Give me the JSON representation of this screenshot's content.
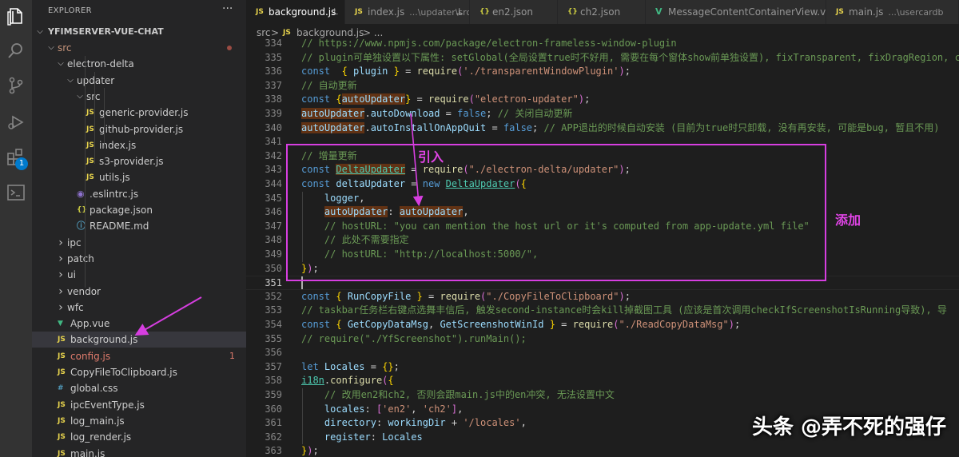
{
  "activity_bar": {
    "icons": [
      "files-icon",
      "search-icon",
      "source-control-icon",
      "run-debug-icon",
      "extensions-icon",
      "remote-explorer-icon"
    ],
    "extensions_badge": "1"
  },
  "sidebar": {
    "title": "EXPLORER",
    "more_actions": "···",
    "root": "YFIMSERVER-VUE-CHAT",
    "items": [
      {
        "label": "src",
        "type": "folder",
        "depth": 1,
        "open": true,
        "modified": true
      },
      {
        "label": "electron-delta",
        "type": "folder",
        "depth": 2,
        "open": true
      },
      {
        "label": "updater",
        "type": "folder",
        "depth": 3,
        "open": true
      },
      {
        "label": "src",
        "type": "folder",
        "depth": 4,
        "open": true
      },
      {
        "label": "generic-provider.js",
        "type": "js",
        "depth": 5
      },
      {
        "label": "github-provider.js",
        "type": "js",
        "depth": 5
      },
      {
        "label": "index.js",
        "type": "js",
        "depth": 5
      },
      {
        "label": "s3-provider.js",
        "type": "js",
        "depth": 5
      },
      {
        "label": "utils.js",
        "type": "js",
        "depth": 5
      },
      {
        "label": ".eslintrc.js",
        "type": "eslint",
        "depth": 4
      },
      {
        "label": "package.json",
        "type": "json",
        "depth": 4
      },
      {
        "label": "README.md",
        "type": "md",
        "depth": 4
      },
      {
        "label": "ipc",
        "type": "folder",
        "depth": 2,
        "open": false
      },
      {
        "label": "patch",
        "type": "folder",
        "depth": 2,
        "open": false
      },
      {
        "label": "ui",
        "type": "folder",
        "depth": 2,
        "open": false
      },
      {
        "label": "vendor",
        "type": "folder",
        "depth": 2,
        "open": false
      },
      {
        "label": "wfc",
        "type": "folder",
        "depth": 2,
        "open": false
      },
      {
        "label": "App.vue",
        "type": "vue",
        "depth": 2
      },
      {
        "label": "background.js",
        "type": "js",
        "depth": 2,
        "selected": true
      },
      {
        "label": "config.js",
        "type": "js",
        "depth": 2,
        "error": true,
        "problems": "1"
      },
      {
        "label": "CopyFileToClipboard.js",
        "type": "js",
        "depth": 2
      },
      {
        "label": "global.css",
        "type": "css",
        "depth": 2
      },
      {
        "label": "ipcEventType.js",
        "type": "js",
        "depth": 2
      },
      {
        "label": "log_main.js",
        "type": "js",
        "depth": 2
      },
      {
        "label": "log_render.js",
        "type": "js",
        "depth": 2
      },
      {
        "label": "main.js",
        "type": "js",
        "depth": 2
      }
    ]
  },
  "tabs": [
    {
      "icon": "JS",
      "label": "background.js",
      "desc": "",
      "active": true,
      "pinned": true
    },
    {
      "icon": "JS",
      "label": "index.js",
      "desc": "...\\updater\\src",
      "active": false,
      "pinned": true
    },
    {
      "icon": "{}",
      "label": "en2.json",
      "desc": "",
      "active": false
    },
    {
      "icon": "{}",
      "label": "ch2.json",
      "desc": "",
      "active": false
    },
    {
      "icon": "V",
      "label": "MessageContentContainerView.vue",
      "desc": "",
      "active": false
    },
    {
      "icon": "JS",
      "label": "main.js",
      "desc": "...\\usercardb",
      "active": false
    }
  ],
  "breadcrumb": {
    "folder": "src",
    "sep": ">",
    "file_icon": "JS",
    "file": "background.js",
    "more": "> ..."
  },
  "editor": {
    "current_line": 351,
    "lines": [
      {
        "n": 334,
        "t": [
          [
            "c",
            "// https://www.npmjs.com/package/electron-frameless-window-plugin"
          ]
        ]
      },
      {
        "n": 335,
        "t": [
          [
            "c",
            "// plugin可单独设置以下属性: setGlobal(全局设置true时不好用, 需要在每个窗体show前单独设置), fixTransparent, fixDragRegion, c"
          ]
        ]
      },
      {
        "n": 336,
        "t": [
          [
            "k",
            "const"
          ],
          [
            "",
            "  "
          ],
          [
            "y",
            "{"
          ],
          [
            "",
            " "
          ],
          [
            "v",
            "plugin"
          ],
          [
            "",
            " "
          ],
          [
            "y",
            "}"
          ],
          [
            "",
            " = "
          ],
          [
            "f",
            "require"
          ],
          [
            "p",
            "("
          ],
          [
            "s",
            "'./transparentWindowPlugin'"
          ],
          [
            "p",
            ")"
          ],
          [
            "",
            ";"
          ]
        ]
      },
      {
        "n": 337,
        "t": [
          [
            "c",
            "// 自动更新"
          ]
        ]
      },
      {
        "n": 338,
        "t": [
          [
            "k",
            "const"
          ],
          [
            "",
            " "
          ],
          [
            "y",
            "{"
          ],
          [
            "vh",
            "autoUpdater"
          ],
          [
            "y",
            "}"
          ],
          [
            "",
            " = "
          ],
          [
            "f",
            "require"
          ],
          [
            "p",
            "("
          ],
          [
            "s",
            "\"electron-updater\""
          ],
          [
            "p",
            ")"
          ],
          [
            "",
            ";"
          ]
        ]
      },
      {
        "n": 339,
        "t": [
          [
            "vh",
            "autoUpdater"
          ],
          [
            "",
            "."
          ],
          [
            "v",
            "autoDownload"
          ],
          [
            "",
            " = "
          ],
          [
            "k",
            "false"
          ],
          [
            "",
            ";"
          ],
          [
            "",
            " "
          ],
          [
            "c",
            "// 关闭自动更新"
          ]
        ]
      },
      {
        "n": 340,
        "t": [
          [
            "vh",
            "autoUpdater"
          ],
          [
            "",
            "."
          ],
          [
            "v",
            "autoInstallOnAppQuit"
          ],
          [
            "",
            " = "
          ],
          [
            "k",
            "false"
          ],
          [
            "",
            ";"
          ],
          [
            "",
            " "
          ],
          [
            "c",
            "// APP退出的时候自动安装 (目前为true时只卸载, 没有再安装, 可能是bug, 暂且不用)"
          ]
        ]
      },
      {
        "n": 341,
        "t": []
      },
      {
        "n": 342,
        "t": [
          [
            "c",
            "// 增量更新"
          ]
        ]
      },
      {
        "n": 343,
        "t": [
          [
            "k",
            "const"
          ],
          [
            "",
            " "
          ],
          [
            "vhu",
            "DeltaUpdater"
          ],
          [
            "",
            " = "
          ],
          [
            "f",
            "require"
          ],
          [
            "p",
            "("
          ],
          [
            "s",
            "\"./electron-delta/updater\""
          ],
          [
            "p",
            ")"
          ],
          [
            "",
            ";"
          ]
        ]
      },
      {
        "n": 344,
        "t": [
          [
            "k",
            "const"
          ],
          [
            "",
            " "
          ],
          [
            "v",
            "deltaUpdater"
          ],
          [
            "",
            " = "
          ],
          [
            "k",
            "new"
          ],
          [
            "",
            " "
          ],
          [
            "tu",
            "DeltaUpdater"
          ],
          [
            "p",
            "("
          ],
          [
            "y",
            "{"
          ]
        ]
      },
      {
        "n": 345,
        "t": [
          [
            "",
            "    "
          ],
          [
            "v",
            "logger"
          ],
          [
            "",
            ","
          ]
        ]
      },
      {
        "n": 346,
        "t": [
          [
            "",
            "    "
          ],
          [
            "vh",
            "autoUpdater"
          ],
          [
            "",
            ": "
          ],
          [
            "vh",
            "autoUpdater"
          ],
          [
            "",
            ","
          ]
        ]
      },
      {
        "n": 347,
        "t": [
          [
            "",
            "    "
          ],
          [
            "c",
            "// hostURL: \"you can mention the host url or it's computed from app-update.yml file\""
          ]
        ]
      },
      {
        "n": 348,
        "t": [
          [
            "",
            "    "
          ],
          [
            "c",
            "// 此处不需要指定"
          ]
        ]
      },
      {
        "n": 349,
        "t": [
          [
            "",
            "    "
          ],
          [
            "c",
            "// hostURL: \"http://localhost:5000/\","
          ]
        ]
      },
      {
        "n": 350,
        "t": [
          [
            "y",
            "}"
          ],
          [
            "p",
            ")"
          ],
          [
            "",
            ";"
          ]
        ]
      },
      {
        "n": 351,
        "t": []
      },
      {
        "n": 352,
        "t": [
          [
            "k",
            "const"
          ],
          [
            "",
            " "
          ],
          [
            "y",
            "{"
          ],
          [
            "",
            " "
          ],
          [
            "v",
            "RunCopyFile"
          ],
          [
            "",
            " "
          ],
          [
            "y",
            "}"
          ],
          [
            "",
            " = "
          ],
          [
            "f",
            "require"
          ],
          [
            "p",
            "("
          ],
          [
            "s",
            "\"./CopyFileToClipboard\""
          ],
          [
            "p",
            ")"
          ],
          [
            "",
            ";"
          ]
        ]
      },
      {
        "n": 353,
        "t": [
          [
            "c",
            "// taskbar任务栏右键点选舞丰信后, 触发second-instance时会kill掉截图工具 (应该是首次调用checkIfScreenshotIsRunning导致), 导"
          ]
        ]
      },
      {
        "n": 354,
        "t": [
          [
            "k",
            "const"
          ],
          [
            "",
            " "
          ],
          [
            "y",
            "{"
          ],
          [
            "",
            " "
          ],
          [
            "v",
            "GetCopyDataMsg"
          ],
          [
            "",
            ", "
          ],
          [
            "v",
            "GetScreenshotWinId"
          ],
          [
            "",
            " "
          ],
          [
            "y",
            "}"
          ],
          [
            "",
            " = "
          ],
          [
            "f",
            "require"
          ],
          [
            "p",
            "("
          ],
          [
            "s",
            "\"./ReadCopyDataMsg\""
          ],
          [
            "p",
            ")"
          ],
          [
            "",
            ";"
          ]
        ]
      },
      {
        "n": 355,
        "t": [
          [
            "c",
            "// require(\"./YfScreenshot\").runMain();"
          ]
        ]
      },
      {
        "n": 356,
        "t": []
      },
      {
        "n": 357,
        "t": [
          [
            "k",
            "let"
          ],
          [
            "",
            " "
          ],
          [
            "v",
            "Locales"
          ],
          [
            "",
            " = "
          ],
          [
            "y",
            "{}"
          ],
          [
            "",
            ";"
          ]
        ]
      },
      {
        "n": 358,
        "t": [
          [
            "vu",
            "i18n"
          ],
          [
            "",
            "."
          ],
          [
            "f",
            "configure"
          ],
          [
            "p",
            "("
          ],
          [
            "y",
            "{"
          ]
        ]
      },
      {
        "n": 359,
        "t": [
          [
            "",
            "    "
          ],
          [
            "c",
            "// 改用en2和ch2, 否则会跟main.js中的en冲突, 无法设置中文"
          ]
        ]
      },
      {
        "n": 360,
        "t": [
          [
            "",
            "    "
          ],
          [
            "v",
            "locales"
          ],
          [
            "",
            ": "
          ],
          [
            "p",
            "["
          ],
          [
            "s",
            "'en2'"
          ],
          [
            "",
            ", "
          ],
          [
            "s",
            "'ch2'"
          ],
          [
            "p",
            "]"
          ],
          [
            "",
            ","
          ]
        ]
      },
      {
        "n": 361,
        "t": [
          [
            "",
            "    "
          ],
          [
            "v",
            "directory"
          ],
          [
            "",
            ": "
          ],
          [
            "v",
            "workingDir"
          ],
          [
            "",
            " + "
          ],
          [
            "s",
            "'/locales'"
          ],
          [
            "",
            ","
          ]
        ]
      },
      {
        "n": 362,
        "t": [
          [
            "",
            "    "
          ],
          [
            "v",
            "register"
          ],
          [
            "",
            ": "
          ],
          [
            "v",
            "Locales"
          ]
        ]
      },
      {
        "n": 363,
        "t": [
          [
            "y",
            "}"
          ],
          [
            "p",
            ")"
          ],
          [
            "",
            ";"
          ]
        ]
      }
    ]
  },
  "annotations": {
    "intro_label": "引入",
    "add_label": "添加",
    "accent_color": "#d63ee0"
  },
  "watermark": "头条 @弄不死的强仔",
  "colors": {
    "keyword": "#569cd6",
    "variable": "#9cdcfe",
    "function": "#dcdcaa",
    "string": "#ce9178",
    "comment": "#6a9955",
    "type": "#4ec9b0",
    "highlight": "#613214",
    "js_icon": "#e8d44d",
    "json_icon": "#cbcb41",
    "vue_icon": "#41b883",
    "css_icon": "#519aba",
    "md_icon": "#519aba",
    "error": "#e07b6c",
    "modified": "#c6947b"
  }
}
